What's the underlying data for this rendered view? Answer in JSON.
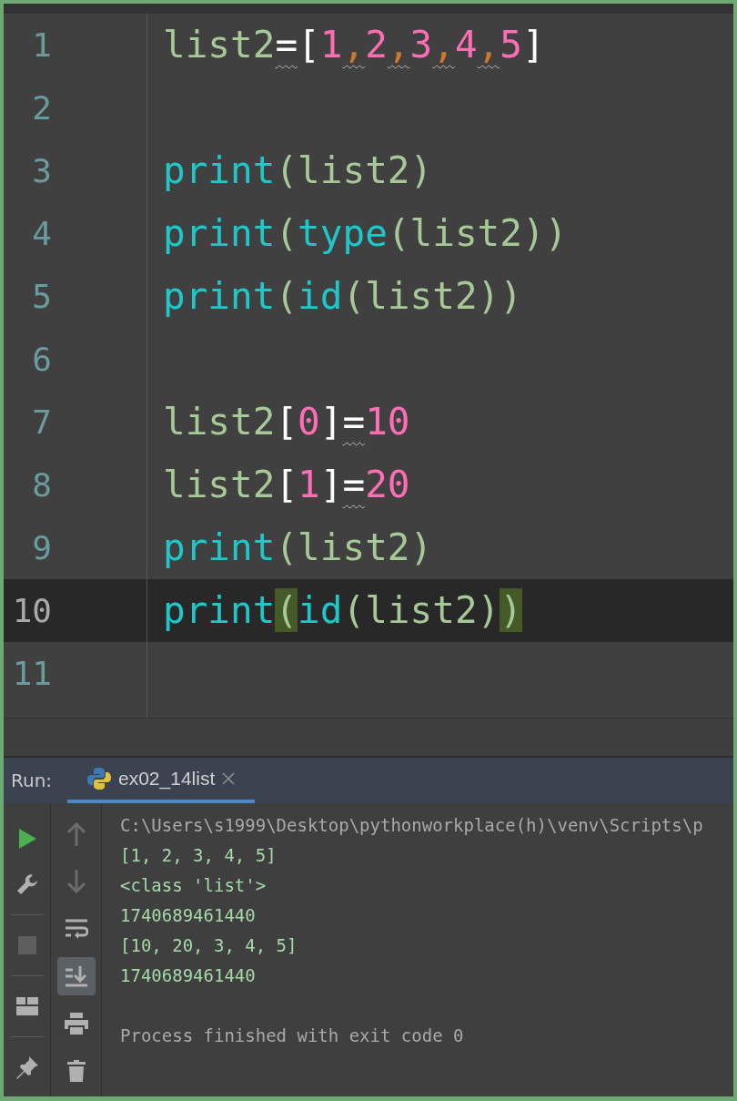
{
  "editor": {
    "lines": [
      {
        "number": "1",
        "current": false,
        "tokens": [
          {
            "kind": "ident",
            "text": "list2",
            "warning": false,
            "matched": false
          },
          {
            "kind": "op",
            "text": "=",
            "warning": true,
            "matched": false
          },
          {
            "kind": "bracket",
            "text": "[",
            "warning": false,
            "matched": false
          },
          {
            "kind": "number",
            "text": "1",
            "warning": false,
            "matched": false
          },
          {
            "kind": "comma",
            "text": ",",
            "warning": true,
            "matched": false
          },
          {
            "kind": "number",
            "text": "2",
            "warning": false,
            "matched": false
          },
          {
            "kind": "comma",
            "text": ",",
            "warning": true,
            "matched": false
          },
          {
            "kind": "number",
            "text": "3",
            "warning": false,
            "matched": false
          },
          {
            "kind": "comma",
            "text": ",",
            "warning": true,
            "matched": false
          },
          {
            "kind": "number",
            "text": "4",
            "warning": false,
            "matched": false
          },
          {
            "kind": "comma",
            "text": ",",
            "warning": true,
            "matched": false
          },
          {
            "kind": "number",
            "text": "5",
            "warning": false,
            "matched": false
          },
          {
            "kind": "bracket",
            "text": "]",
            "warning": false,
            "matched": false
          }
        ]
      },
      {
        "number": "2",
        "current": false
      },
      {
        "number": "3",
        "current": false,
        "tokens": [
          {
            "kind": "func",
            "text": "print",
            "warning": false,
            "matched": false
          },
          {
            "kind": "paren",
            "text": "(list2)",
            "warning": false,
            "matched": false
          }
        ]
      },
      {
        "number": "4",
        "current": false,
        "tokens": [
          {
            "kind": "func",
            "text": "print",
            "warning": false,
            "matched": false
          },
          {
            "kind": "paren",
            "text": "(",
            "warning": false,
            "matched": false
          },
          {
            "kind": "func",
            "text": "type",
            "warning": false,
            "matched": false
          },
          {
            "kind": "paren",
            "text": "(list2))",
            "warning": false,
            "matched": false
          }
        ]
      },
      {
        "number": "5",
        "current": false,
        "tokens": [
          {
            "kind": "func",
            "text": "print",
            "warning": false,
            "matched": false
          },
          {
            "kind": "paren",
            "text": "(",
            "warning": false,
            "matched": false
          },
          {
            "kind": "func",
            "text": "id",
            "warning": false,
            "matched": false
          },
          {
            "kind": "paren",
            "text": "(list2))",
            "warning": false,
            "matched": false
          }
        ]
      },
      {
        "number": "6",
        "current": false
      },
      {
        "number": "7",
        "current": false,
        "tokens": [
          {
            "kind": "ident",
            "text": "list2",
            "warning": false,
            "matched": false
          },
          {
            "kind": "bracket",
            "text": "[",
            "warning": false,
            "matched": false
          },
          {
            "kind": "number",
            "text": "0",
            "warning": false,
            "matched": false
          },
          {
            "kind": "bracket",
            "text": "]",
            "warning": false,
            "matched": false
          },
          {
            "kind": "op",
            "text": "=",
            "warning": true,
            "matched": false
          },
          {
            "kind": "number",
            "text": "10",
            "warning": false,
            "matched": false
          }
        ]
      },
      {
        "number": "8",
        "current": false,
        "tokens": [
          {
            "kind": "ident",
            "text": "list2",
            "warning": false,
            "matched": false
          },
          {
            "kind": "bracket",
            "text": "[",
            "warning": false,
            "matched": false
          },
          {
            "kind": "number",
            "text": "1",
            "warning": false,
            "matched": false
          },
          {
            "kind": "bracket",
            "text": "]",
            "warning": false,
            "matched": false
          },
          {
            "kind": "op",
            "text": "=",
            "warning": true,
            "matched": false
          },
          {
            "kind": "number",
            "text": "20",
            "warning": false,
            "matched": false
          }
        ]
      },
      {
        "number": "9",
        "current": false,
        "tokens": [
          {
            "kind": "func",
            "text": "print",
            "warning": false,
            "matched": false
          },
          {
            "kind": "paren",
            "text": "(list2)",
            "warning": false,
            "matched": false
          }
        ]
      },
      {
        "number": "10",
        "current": true,
        "tokens": [
          {
            "kind": "func",
            "text": "print",
            "warning": false,
            "matched": false
          },
          {
            "kind": "paren",
            "text": "(",
            "warning": false,
            "matched": true
          },
          {
            "kind": "func",
            "text": "id",
            "warning": false,
            "matched": false
          },
          {
            "kind": "paren",
            "text": "(list2)",
            "warning": false,
            "matched": false
          },
          {
            "kind": "paren",
            "text": ")",
            "warning": false,
            "matched": true
          }
        ]
      },
      {
        "number": "11",
        "current": false
      }
    ]
  },
  "run_panel": {
    "label": "Run:",
    "tabs": [
      {
        "label": "ex02_14list",
        "selected": true
      }
    ],
    "left_toolbar": [
      {
        "kind": "run"
      },
      {
        "kind": "wrench"
      },
      {
        "kind": "separator"
      },
      {
        "kind": "stop"
      },
      {
        "kind": "separator"
      },
      {
        "kind": "layout"
      },
      {
        "kind": "separator"
      },
      {
        "kind": "pin"
      }
    ],
    "console_toolbar": [
      {
        "kind": "up",
        "disabled": true,
        "on": false
      },
      {
        "kind": "down",
        "disabled": true,
        "on": false
      },
      {
        "kind": "soft-wrap",
        "disabled": false,
        "on": false
      },
      {
        "kind": "scroll-to-end",
        "disabled": false,
        "on": true
      },
      {
        "kind": "print",
        "disabled": false,
        "on": false
      },
      {
        "kind": "delete",
        "disabled": false,
        "on": false
      }
    ],
    "console": [
      {
        "kind": "command",
        "text": "C:\\Users\\s1999\\Desktop\\pythonworkplace(h)\\venv\\Scripts\\p"
      },
      {
        "kind": "output",
        "text": "[1, 2, 3, 4, 5]"
      },
      {
        "kind": "output",
        "text": "<class 'list'>"
      },
      {
        "kind": "output",
        "text": "1740689461440"
      },
      {
        "kind": "output",
        "text": "[10, 20, 3, 4, 5]"
      },
      {
        "kind": "output",
        "text": "1740689461440"
      },
      {
        "kind": "status",
        "text": "Process finished with exit code 0"
      }
    ]
  }
}
